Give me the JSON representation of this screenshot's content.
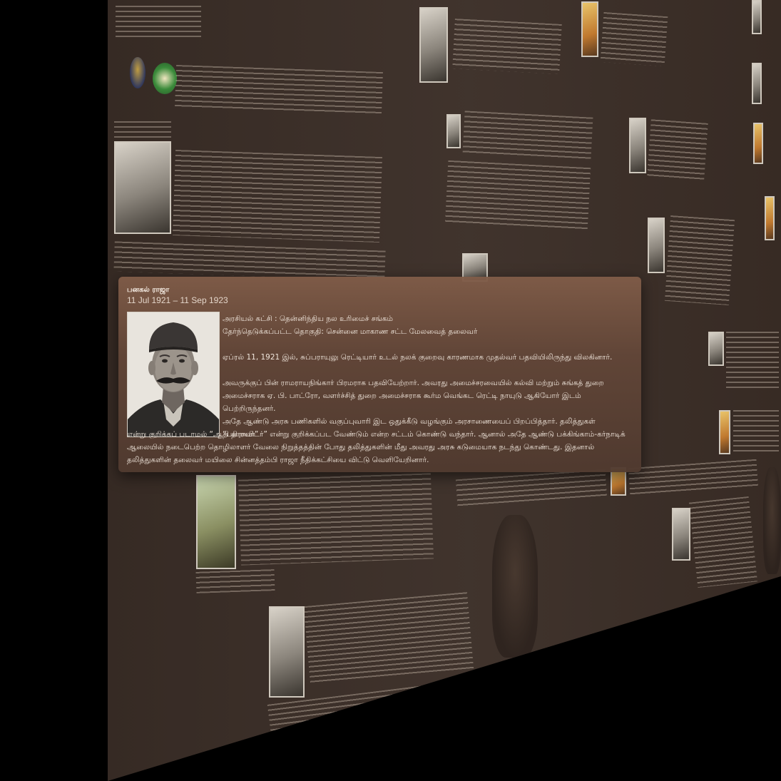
{
  "detail": {
    "name": "பனகல் ராஜா",
    "dates": "11 Jul 1921 – 11 Sep 1923",
    "party_line": "அரசியல் கட்சி : தென்னிந்திய நல உரிமைச் சங்கம்",
    "constituency_line": "தேர்ந்தெடுக்கப்பட்ட தொகுதி: சென்னை மாகாண சட்ட மேலவைத் தலைவர்",
    "paragraph_1": "ஏப்ரல் 11, 1921 இல், சுப்பராயுலு ரெட்டியார் உடல் நலக் குறைவு காரணமாக முதல்வர் பதவியிலிருந்து விலகினார்.",
    "paragraph_2": "அவருக்குப் பின் ராமராயநிங்கார் பிரமராக பதவியேற்றார். அவரது அமைச்சரவையில் கல்வி மற்றும் சுங்கத் துறை அமைச்சராக ஏ. பி. பாட்ரோ, வளர்ச்சித் துறை அமைச்சராக கூர்ம வெங்கட ரெட்டி நாயுடு ஆகியோர் இடம் பெற்றிருந்தனர்.",
    "paragraph_3a": "அதே ஆண்டு அரசு பணிகளில் வகுப்புவாரி இட ஒதுக்கீடு வழங்கும் அரசாணையைப் பிறப்பித்தார். தலித்துகள் “பறையர்”",
    "paragraph_3b": "என்று குறிக்கப் படாமல் “ஆதி திராவிடர்” என்று குறிக்கப்பட வேண்டும் என்ற சட்டம் கொண்டு வந்தார். ஆனால் அதே ஆண்டு பக்கிங்காம்-கர்நாடிக் ஆலையில் நடைபெற்ற தொழிலாளர் வேலை நிறுத்தத்தின் போது தலித்துகளின் மீது அவரது அரசு கடுமையாக நடந்து கொண்டது. இதனால் தலித்துகளின் தலைவர் மயிலை சின்னத்தம்பி ராஜா நீதிக்கட்சியை விட்டு வெளியேறினார்."
  },
  "colors": {
    "wall": "#3a2d26",
    "popup_top": "#805c48",
    "popup_bottom": "#503a2f",
    "text": "#f0e6dc"
  }
}
